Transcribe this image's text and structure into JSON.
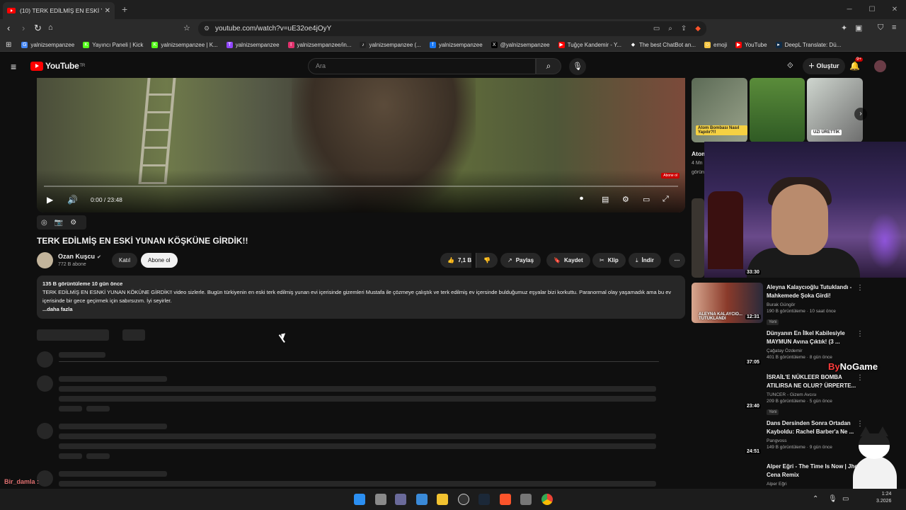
{
  "browser": {
    "tab_title": "(10) TERK EDİLMİŞ EN ESKİ YUNA",
    "url": "youtube.com/watch?v=uE32oe4jOyY",
    "bookmarks": [
      {
        "label": "yalnizsempanzee",
        "color": "#4285f4",
        "icon": "G"
      },
      {
        "label": "Yayıncı Paneli | Kick",
        "color": "#53fc18",
        "icon": "K"
      },
      {
        "label": "yalnizsempanzee | K...",
        "color": "#53fc18",
        "icon": "K"
      },
      {
        "label": "yalnizsempanzee",
        "color": "#9146ff",
        "icon": "T"
      },
      {
        "label": "yalnizsempanzee/in...",
        "color": "#e1306c",
        "icon": "I"
      },
      {
        "label": "yalnizsempanzee (...",
        "color": "#222222",
        "icon": "♪"
      },
      {
        "label": "yalnizsempanzee",
        "color": "#1877f2",
        "icon": "f"
      },
      {
        "label": "@yalnizsempanzee",
        "color": "#000000",
        "icon": "X"
      },
      {
        "label": "Tuğçe Kandemir - Y...",
        "color": "#ff0000",
        "icon": "▶"
      },
      {
        "label": "The best ChatBot an...",
        "color": "#2b2b2b",
        "icon": "◆"
      },
      {
        "label": "emoji",
        "color": "#f5c542",
        "icon": "☺"
      },
      {
        "label": "YouTube",
        "color": "#ff0000",
        "icon": "▶"
      },
      {
        "label": "DeepL Translate: Dü...",
        "color": "#0f2b46",
        "icon": "▸"
      }
    ]
  },
  "youtube": {
    "logo_text": "YouTube",
    "logo_region": "TR",
    "search_placeholder": "Ara",
    "create_label": "Oluştur",
    "notif_count": "9+"
  },
  "player": {
    "time": "0:00 / 23:48",
    "progress": 0
  },
  "video": {
    "title": "TERK EDİLMİŞ EN ESKİ YUNAN KÖŞKÜNE GİRDİK!!",
    "channel": "Ozan Kuşcu",
    "subs": "772 B abone",
    "join_label": "Katıl",
    "subscribe_label": "Abone ol",
    "likes": "7,1 B",
    "share_label": "Paylaş",
    "save_label": "Kaydet",
    "clip_label": "Klip",
    "download_label": "İndir",
    "description_meta": "135 B görüntüleme  10 gün önce",
    "description_text": "TERK EDİLMİŞ EN ESNKİ YUNAN KÖKÜNE GİRDİK!! video sizlerle. Bugün türkiyenin en eski terk edilmiş yunan evi içerisinde gizemleri Mustafa ile çözmeye çalıştık ve terk edilmiş ev içersinde bulduğumuz eşyalar bizi korkuttu. Paranormal olay yaşamadık ama bu ev içerisinde bir gece geçirmek için sabırsızım. İyi seyirler.",
    "description_more": "...daha fazla"
  },
  "sidebar": {
    "shelf_captions": [
      "Atom Bombası Nasıl Yapılır?!!",
      "",
      "UZI ÜRETTİK"
    ],
    "cut_title": "Atom Bomb",
    "cut_meta1": "4 Mn",
    "cut_meta2": "görün",
    "cut_duration": "33:30",
    "items": [
      {
        "title": "Aleyna Kalaycıoğlu Tutuklandı - Mahkemede Şoka Girdi!",
        "channel": "Burak Güngör",
        "views": "190 B görüntüleme · 10 saat önce",
        "badge": "Yeni",
        "duration": "12:31",
        "thumb_text": "ALEYNA KALAYCIO... TUTUKLANDI"
      },
      {
        "title": "Dünyanın En İlkel Kabilesiyle MAYMUN Avına Çıktık! (3 ...",
        "channel": "Çağatay Özdemir",
        "views": "401 B görüntüleme · 8 gün önce",
        "badge": "",
        "duration": "37:05",
        "thumb_text": ""
      },
      {
        "title": "İSRAİL'E NÜKLEER BOMBA ATILIRSA NE OLUR? ÜRPERTE...",
        "channel": "TUNCER - Gizem Avcısı",
        "views": "209 B görüntüleme · 5 gün önce",
        "badge": "Yeni",
        "duration": "23:40",
        "thumb_text": ""
      },
      {
        "title": "Dans Dersinden Sonra Ortadan Kayboldu: Rachel Barber'a Ne ...",
        "channel": "Pangvoss",
        "views": "149 B görüntüleme · 9 gün önce",
        "badge": "",
        "duration": "24:51",
        "thumb_text": ""
      },
      {
        "title": "Alper Eğri - The Time Is Now | Jhon Cena Remix",
        "channel": "Alper Eğri",
        "views": "",
        "badge": "",
        "duration": "",
        "thumb_text": ""
      }
    ]
  },
  "overlay": {
    "watermark_prefix": "By",
    "watermark_main": "NoGame",
    "chat_user": "Bir_damla :"
  },
  "taskbar": {
    "time": "1:24",
    "date": "3.2026"
  }
}
